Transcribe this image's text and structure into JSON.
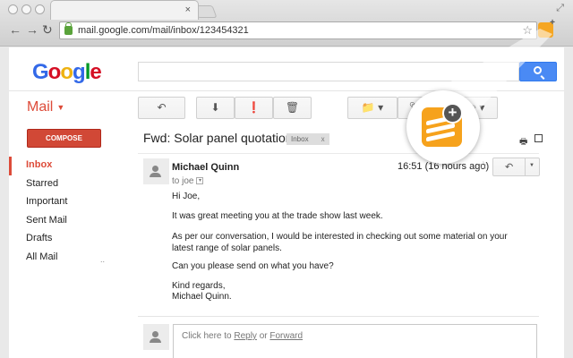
{
  "browser": {
    "url": "mail.google.com/mail/inbox/123454321",
    "tab_close": "×"
  },
  "google": {
    "logo_letters": [
      {
        "char": "G",
        "color": "#3369e8"
      },
      {
        "char": "o",
        "color": "#d50f25"
      },
      {
        "char": "o",
        "color": "#eeb211"
      },
      {
        "char": "g",
        "color": "#3369e8"
      },
      {
        "char": "l",
        "color": "#009925"
      },
      {
        "char": "e",
        "color": "#d50f25"
      }
    ]
  },
  "mail": {
    "label": "Mail",
    "compose": "COMPOSE",
    "folders": [
      "Inbox",
      "Starred",
      "Important",
      "Sent Mail",
      "Drafts",
      "All Mail"
    ],
    "more_dots": ".."
  },
  "toolbar": {
    "more_label": "ore"
  },
  "thread": {
    "subject": "Fwd: Solar panel quotation",
    "badge": "Inbox",
    "badge_close": "x"
  },
  "message": {
    "sender": "Michael Quinn",
    "to": "to joe",
    "time": "16:51 (16 hours ago)",
    "body": {
      "greeting": "Hi Joe,",
      "p1": "It was great meeting you at the trade show last week.",
      "p2": "As per our conversation, I would be interested in checking out some material on your latest range of solar panels.",
      "p3": "Can you please send on what you have?",
      "signoff": "Kind regards,",
      "signature": "Michael Quinn."
    }
  },
  "reply": {
    "prefix": "Click here to ",
    "reply_link": "Reply",
    "or": " or ",
    "forward_link": "Forward"
  },
  "colors": {
    "accent_red": "#dd4b39",
    "search_blue": "#4a8af4",
    "extension_orange": "#f6a21c"
  }
}
